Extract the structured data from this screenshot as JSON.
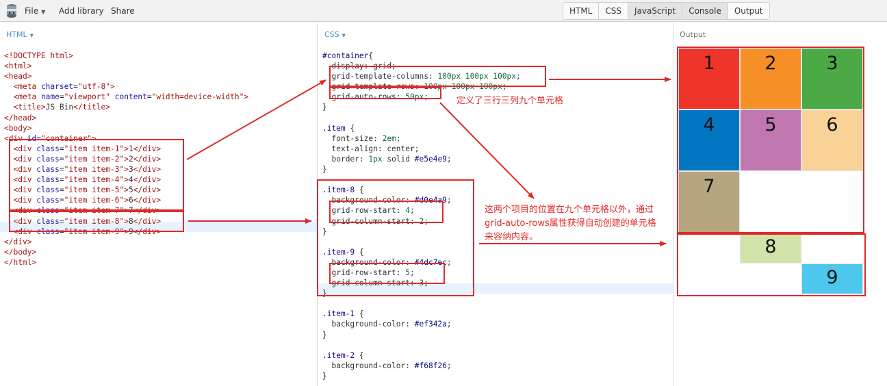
{
  "toolbar": {
    "file_label": "File",
    "add_library_label": "Add library",
    "share_label": "Share",
    "panel_tabs": [
      "HTML",
      "CSS",
      "JavaScript",
      "Console",
      "Output"
    ],
    "active_tabs": [
      "HTML",
      "CSS",
      "Output"
    ]
  },
  "html_panel": {
    "label": "HTML",
    "lines": [
      "<!DOCTYPE html>",
      "<html>",
      "<head>",
      "  <meta charset=\"utf-8\">",
      "  <meta name=\"viewport\" content=\"width=device-width\">",
      "  <title>JS Bin</title>",
      "</head>",
      "<body>",
      "<div id=\"container\">",
      "  <div class=\"item item-1\">1</div>",
      "  <div class=\"item item-2\">2</div>",
      "  <div class=\"item item-3\">3</div>",
      "  <div class=\"item item-4\">4</div>",
      "  <div class=\"item item-5\">5</div>",
      "  <div class=\"item item-6\">6</div>",
      "  <div class=\"item item-7\">7</div>",
      "  <div class=\"item item-8\">8</div>",
      "  <div class=\"item item-9\">9</div>",
      "</div>",
      "</body>",
      "</html>"
    ]
  },
  "css_panel": {
    "label": "CSS",
    "lines": [
      "#container{",
      "  display: grid;",
      "  grid-template-columns: 100px 100px 100px;",
      "  grid-template-rows: 100px 100px 100px;",
      "  grid-auto-rows: 50px;",
      "}",
      "",
      ".item {",
      "  font-size: 2em;",
      "  text-align: center;",
      "  border: 1px solid #e5e4e9;",
      "}",
      "",
      ".item-8 {",
      "  background-color: #d0e4a9;",
      "  grid-row-start: 4;",
      "  grid-column-start: 2;",
      "}",
      "",
      ".item-9 {",
      "  background-color: #4dc7ec;",
      "  grid-row-start: 5;",
      "  grid-column-start: 3;",
      "}",
      "",
      ".item-1 {",
      "  background-color: #ef342a;",
      "}",
      "",
      ".item-2 {",
      "  background-color: #f68f26;",
      "}"
    ]
  },
  "output_panel": {
    "label": "Output",
    "items": [
      {
        "label": "1",
        "color": "#ef342a"
      },
      {
        "label": "2",
        "color": "#f68f26"
      },
      {
        "label": "3",
        "color": "#4ba946"
      },
      {
        "label": "4",
        "color": "#0376c2"
      },
      {
        "label": "5",
        "color": "#c077af"
      },
      {
        "label": "6",
        "color": "#f8d296"
      },
      {
        "label": "7",
        "color": "#b5a67f"
      },
      {
        "label": "8",
        "color": "#d0e4a9"
      },
      {
        "label": "9",
        "color": "#4dc7ec"
      }
    ]
  },
  "annotations": {
    "note1": "定义了三行三列九个单元格",
    "note2_lines": [
      "这两个项目的位置在九个单元格以外，通过",
      "grid-auto-rows属性获得自动创建的单元格",
      "来容纳内容。"
    ],
    "color": "#e02a2a"
  }
}
